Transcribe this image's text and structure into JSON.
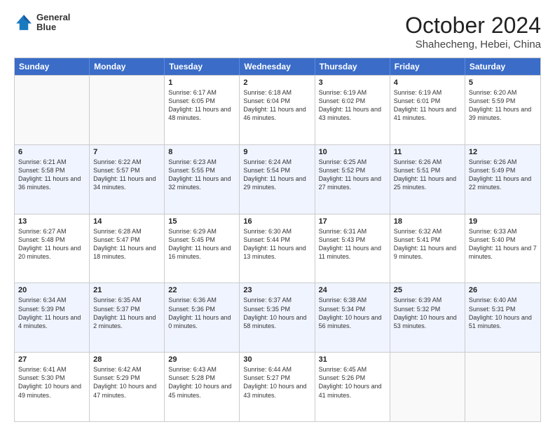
{
  "header": {
    "logo_line1": "General",
    "logo_line2": "Blue",
    "month": "October 2024",
    "location": "Shahecheng, Hebei, China"
  },
  "weekdays": [
    "Sunday",
    "Monday",
    "Tuesday",
    "Wednesday",
    "Thursday",
    "Friday",
    "Saturday"
  ],
  "weeks": [
    [
      {
        "day": "",
        "sunrise": "",
        "sunset": "",
        "daylight": "",
        "empty": true
      },
      {
        "day": "",
        "sunrise": "",
        "sunset": "",
        "daylight": "",
        "empty": true
      },
      {
        "day": "1",
        "sunrise": "Sunrise: 6:17 AM",
        "sunset": "Sunset: 6:05 PM",
        "daylight": "Daylight: 11 hours and 48 minutes.",
        "empty": false
      },
      {
        "day": "2",
        "sunrise": "Sunrise: 6:18 AM",
        "sunset": "Sunset: 6:04 PM",
        "daylight": "Daylight: 11 hours and 46 minutes.",
        "empty": false
      },
      {
        "day": "3",
        "sunrise": "Sunrise: 6:19 AM",
        "sunset": "Sunset: 6:02 PM",
        "daylight": "Daylight: 11 hours and 43 minutes.",
        "empty": false
      },
      {
        "day": "4",
        "sunrise": "Sunrise: 6:19 AM",
        "sunset": "Sunset: 6:01 PM",
        "daylight": "Daylight: 11 hours and 41 minutes.",
        "empty": false
      },
      {
        "day": "5",
        "sunrise": "Sunrise: 6:20 AM",
        "sunset": "Sunset: 5:59 PM",
        "daylight": "Daylight: 11 hours and 39 minutes.",
        "empty": false
      }
    ],
    [
      {
        "day": "6",
        "sunrise": "Sunrise: 6:21 AM",
        "sunset": "Sunset: 5:58 PM",
        "daylight": "Daylight: 11 hours and 36 minutes.",
        "empty": false
      },
      {
        "day": "7",
        "sunrise": "Sunrise: 6:22 AM",
        "sunset": "Sunset: 5:57 PM",
        "daylight": "Daylight: 11 hours and 34 minutes.",
        "empty": false
      },
      {
        "day": "8",
        "sunrise": "Sunrise: 6:23 AM",
        "sunset": "Sunset: 5:55 PM",
        "daylight": "Daylight: 11 hours and 32 minutes.",
        "empty": false
      },
      {
        "day": "9",
        "sunrise": "Sunrise: 6:24 AM",
        "sunset": "Sunset: 5:54 PM",
        "daylight": "Daylight: 11 hours and 29 minutes.",
        "empty": false
      },
      {
        "day": "10",
        "sunrise": "Sunrise: 6:25 AM",
        "sunset": "Sunset: 5:52 PM",
        "daylight": "Daylight: 11 hours and 27 minutes.",
        "empty": false
      },
      {
        "day": "11",
        "sunrise": "Sunrise: 6:26 AM",
        "sunset": "Sunset: 5:51 PM",
        "daylight": "Daylight: 11 hours and 25 minutes.",
        "empty": false
      },
      {
        "day": "12",
        "sunrise": "Sunrise: 6:26 AM",
        "sunset": "Sunset: 5:49 PM",
        "daylight": "Daylight: 11 hours and 22 minutes.",
        "empty": false
      }
    ],
    [
      {
        "day": "13",
        "sunrise": "Sunrise: 6:27 AM",
        "sunset": "Sunset: 5:48 PM",
        "daylight": "Daylight: 11 hours and 20 minutes.",
        "empty": false
      },
      {
        "day": "14",
        "sunrise": "Sunrise: 6:28 AM",
        "sunset": "Sunset: 5:47 PM",
        "daylight": "Daylight: 11 hours and 18 minutes.",
        "empty": false
      },
      {
        "day": "15",
        "sunrise": "Sunrise: 6:29 AM",
        "sunset": "Sunset: 5:45 PM",
        "daylight": "Daylight: 11 hours and 16 minutes.",
        "empty": false
      },
      {
        "day": "16",
        "sunrise": "Sunrise: 6:30 AM",
        "sunset": "Sunset: 5:44 PM",
        "daylight": "Daylight: 11 hours and 13 minutes.",
        "empty": false
      },
      {
        "day": "17",
        "sunrise": "Sunrise: 6:31 AM",
        "sunset": "Sunset: 5:43 PM",
        "daylight": "Daylight: 11 hours and 11 minutes.",
        "empty": false
      },
      {
        "day": "18",
        "sunrise": "Sunrise: 6:32 AM",
        "sunset": "Sunset: 5:41 PM",
        "daylight": "Daylight: 11 hours and 9 minutes.",
        "empty": false
      },
      {
        "day": "19",
        "sunrise": "Sunrise: 6:33 AM",
        "sunset": "Sunset: 5:40 PM",
        "daylight": "Daylight: 11 hours and 7 minutes.",
        "empty": false
      }
    ],
    [
      {
        "day": "20",
        "sunrise": "Sunrise: 6:34 AM",
        "sunset": "Sunset: 5:39 PM",
        "daylight": "Daylight: 11 hours and 4 minutes.",
        "empty": false
      },
      {
        "day": "21",
        "sunrise": "Sunrise: 6:35 AM",
        "sunset": "Sunset: 5:37 PM",
        "daylight": "Daylight: 11 hours and 2 minutes.",
        "empty": false
      },
      {
        "day": "22",
        "sunrise": "Sunrise: 6:36 AM",
        "sunset": "Sunset: 5:36 PM",
        "daylight": "Daylight: 11 hours and 0 minutes.",
        "empty": false
      },
      {
        "day": "23",
        "sunrise": "Sunrise: 6:37 AM",
        "sunset": "Sunset: 5:35 PM",
        "daylight": "Daylight: 10 hours and 58 minutes.",
        "empty": false
      },
      {
        "day": "24",
        "sunrise": "Sunrise: 6:38 AM",
        "sunset": "Sunset: 5:34 PM",
        "daylight": "Daylight: 10 hours and 56 minutes.",
        "empty": false
      },
      {
        "day": "25",
        "sunrise": "Sunrise: 6:39 AM",
        "sunset": "Sunset: 5:32 PM",
        "daylight": "Daylight: 10 hours and 53 minutes.",
        "empty": false
      },
      {
        "day": "26",
        "sunrise": "Sunrise: 6:40 AM",
        "sunset": "Sunset: 5:31 PM",
        "daylight": "Daylight: 10 hours and 51 minutes.",
        "empty": false
      }
    ],
    [
      {
        "day": "27",
        "sunrise": "Sunrise: 6:41 AM",
        "sunset": "Sunset: 5:30 PM",
        "daylight": "Daylight: 10 hours and 49 minutes.",
        "empty": false
      },
      {
        "day": "28",
        "sunrise": "Sunrise: 6:42 AM",
        "sunset": "Sunset: 5:29 PM",
        "daylight": "Daylight: 10 hours and 47 minutes.",
        "empty": false
      },
      {
        "day": "29",
        "sunrise": "Sunrise: 6:43 AM",
        "sunset": "Sunset: 5:28 PM",
        "daylight": "Daylight: 10 hours and 45 minutes.",
        "empty": false
      },
      {
        "day": "30",
        "sunrise": "Sunrise: 6:44 AM",
        "sunset": "Sunset: 5:27 PM",
        "daylight": "Daylight: 10 hours and 43 minutes.",
        "empty": false
      },
      {
        "day": "31",
        "sunrise": "Sunrise: 6:45 AM",
        "sunset": "Sunset: 5:26 PM",
        "daylight": "Daylight: 10 hours and 41 minutes.",
        "empty": false
      },
      {
        "day": "",
        "sunrise": "",
        "sunset": "",
        "daylight": "",
        "empty": true
      },
      {
        "day": "",
        "sunrise": "",
        "sunset": "",
        "daylight": "",
        "empty": true
      }
    ]
  ]
}
